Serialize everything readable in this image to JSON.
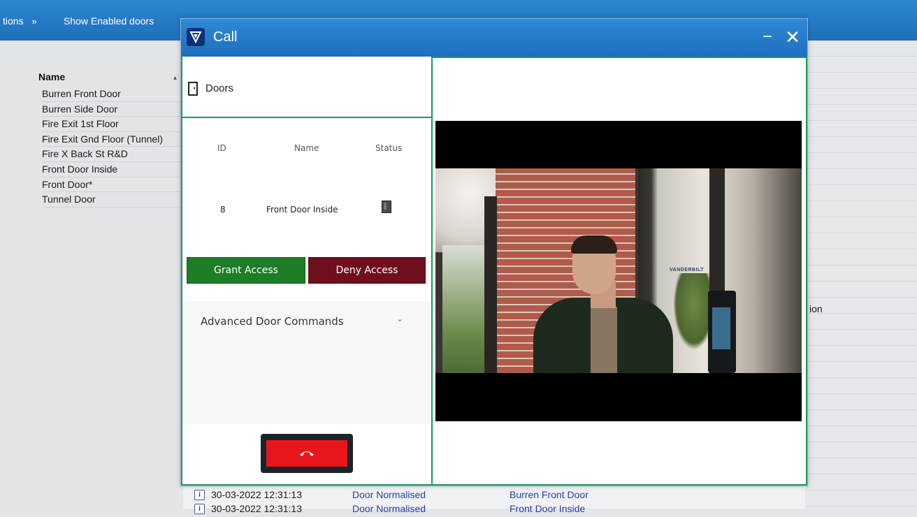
{
  "background_app": {
    "toolbar": {
      "options_label": "tions",
      "options_chevron": "»",
      "show_enabled_label": "Show Enabled doors"
    },
    "door_list": {
      "header": "Name",
      "items": [
        "Burren Front Door",
        "Burren Side Door",
        "Fire Exit 1st Floor",
        "Fire Exit Gnd Floor (Tunnel)",
        "Fire X Back St R&D",
        "Front Door Inside",
        "Front Door*",
        "Tunnel Door"
      ]
    },
    "right_panel_text": "ion",
    "events": [
      {
        "time": "30-03-2022 12:31:13",
        "type": "Door Normalised",
        "door": "Burren Front Door"
      },
      {
        "time": "30-03-2022 12:31:13",
        "type": "Door Normalised",
        "door": "Front Door Inside"
      }
    ]
  },
  "dialog": {
    "title": "Call",
    "minimize_glyph": "−",
    "close_glyph": "✕",
    "doors_header": "Doors",
    "table": {
      "columns": [
        "ID",
        "Name",
        "Status"
      ],
      "rows": [
        {
          "id": "8",
          "name": "Front Door Inside",
          "status_icon": "door-closed-icon"
        }
      ]
    },
    "grant_label": "Grant Access",
    "deny_label": "Deny Access",
    "advanced_label": "Advanced Door Commands",
    "advanced_chevron": "⌄",
    "colors": {
      "titlebar": "#1e6fbd",
      "border_green": "#1b9a5a",
      "grant": "#1e7d27",
      "deny": "#6f0f1d",
      "hangup": "#e8151c"
    },
    "video_sign_text": "VANDERBILT"
  }
}
